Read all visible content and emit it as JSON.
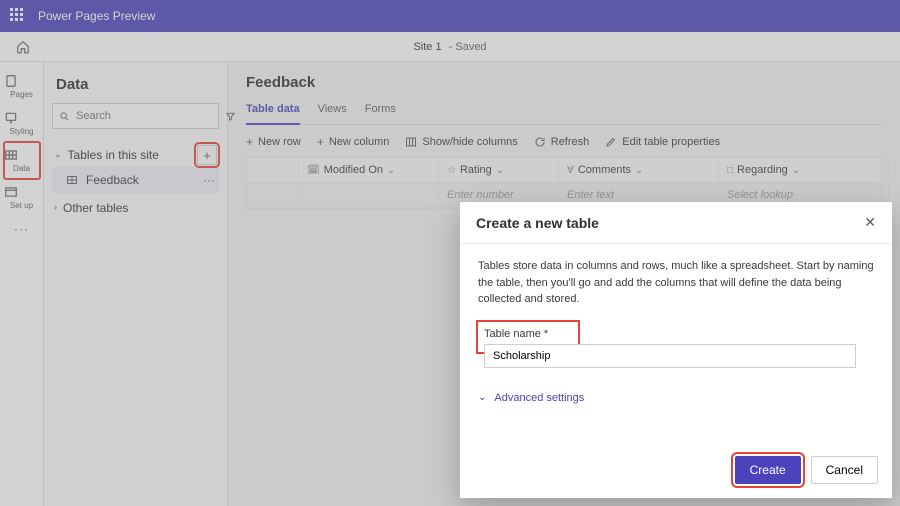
{
  "topbar": {
    "product": "Power Pages Preview"
  },
  "subbar": {
    "site_name": "Site 1",
    "state": "- Saved"
  },
  "rail": [
    {
      "label": "Pages"
    },
    {
      "label": "Styling"
    },
    {
      "label": "Data"
    },
    {
      "label": "Set up"
    }
  ],
  "side": {
    "title": "Data",
    "search_placeholder": "Search",
    "group1": "Tables in this site",
    "rows": [
      {
        "name": "Feedback"
      }
    ],
    "group2": "Other tables"
  },
  "content": {
    "title": "Feedback",
    "tabs": [
      "Table data",
      "Views",
      "Forms"
    ],
    "commands": {
      "new_row": "New row",
      "new_col": "New column",
      "showhide": "Show/hide columns",
      "refresh": "Refresh",
      "edit": "Edit table properties"
    },
    "cols": [
      "Modified On",
      "Rating",
      "Comments",
      "Regarding"
    ],
    "placeholders": {
      "num": "Enter number",
      "text": "Enter text",
      "lookup": "Select lookup"
    }
  },
  "modal": {
    "title": "Create a new table",
    "desc": "Tables store data in columns and rows, much like a spreadsheet. Start by naming the table, then you'll go and add the columns that will define the data being collected and stored.",
    "field_label": "Table name *",
    "field_value": "Scholarship",
    "advanced": "Advanced settings",
    "create": "Create",
    "cancel": "Cancel"
  }
}
